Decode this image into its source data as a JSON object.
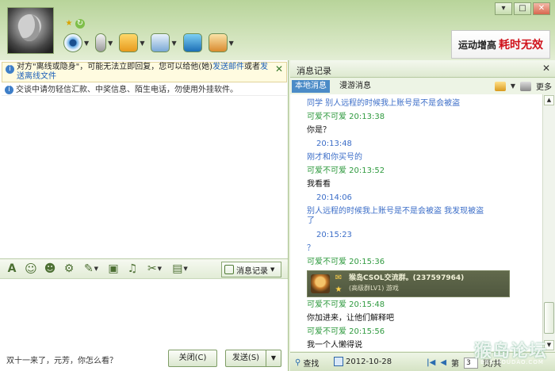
{
  "window": {
    "ctrl_minimize": "▾",
    "ctrl_max": "□",
    "ctrl_close": "✕"
  },
  "ad": {
    "text1": "运动增高",
    "text2": "耗时无效"
  },
  "notice": {
    "line1_pre": "对方\"离线或隐身\"，可能无法立即回复，您可以给他(她)",
    "link_mail": "发送邮件",
    "mid": "或者",
    "link_offline_file": "发送离线文件",
    "safety": "交谈中请勿轻信汇款、中奖信息、陌生电话，勿使用外挂软件。",
    "close": "✕"
  },
  "compose": {
    "history_button": "消息记录",
    "input_text": "双十一来了，元芳，你怎么看？",
    "close_button": "关闭(C)",
    "send_button": "发送(S)",
    "send_arrow": "▼"
  },
  "history": {
    "title": "消息记录",
    "tab_local": "本地消息",
    "tab_roam": "漫游消息",
    "more": "更多",
    "card_title": "猴岛CSOL交流群。(237597964)",
    "card_sub": "(高级群LV1) 游戏",
    "messages": [
      {
        "text": "同学  别人远程的时候我上账号是不是会被盗",
        "color": "blue"
      },
      {
        "text": "可爱不可爱  20:13:38",
        "color": "green"
      },
      {
        "text": "你是？",
        "color": "black"
      },
      {
        "text": "20:13:48",
        "color": "blue"
      },
      {
        "text": "刚才和你买号的",
        "color": "blue"
      },
      {
        "text": "可爱不可爱  20:13:52",
        "color": "green"
      },
      {
        "text": "我看看",
        "color": "black"
      },
      {
        "text": "20:14:06",
        "color": "blue"
      },
      {
        "text": "别人远程的时候我上账号是不是会被盗    我发现被盗",
        "color": "blue"
      },
      {
        "text": "了",
        "color": "blue"
      },
      {
        "text": "20:15:23",
        "color": "blue"
      },
      {
        "text": "？",
        "color": "blue"
      },
      {
        "text": "可爱不可爱  20:15:36",
        "color": "green"
      },
      {
        "text": "可爱不可爱  20:15:48",
        "color": "green"
      },
      {
        "text": "你加进来，让他们解释吧",
        "color": "black"
      },
      {
        "text": "可爱不可爱  20:15:56",
        "color": "green"
      },
      {
        "text": "我一个人懒得说",
        "color": "black"
      }
    ],
    "find": "查找",
    "date": "2012-10-28",
    "page_prefix": "第",
    "page_value": "3",
    "page_suffix": "页/共"
  },
  "watermark": {
    "main": "猴岛论坛",
    "sub": "BBS.HOUDAO.COM"
  },
  "colors": {
    "accent": "#4b8bc7",
    "green_text": "#2f9a3f",
    "blue_text": "#3c6ec8"
  }
}
